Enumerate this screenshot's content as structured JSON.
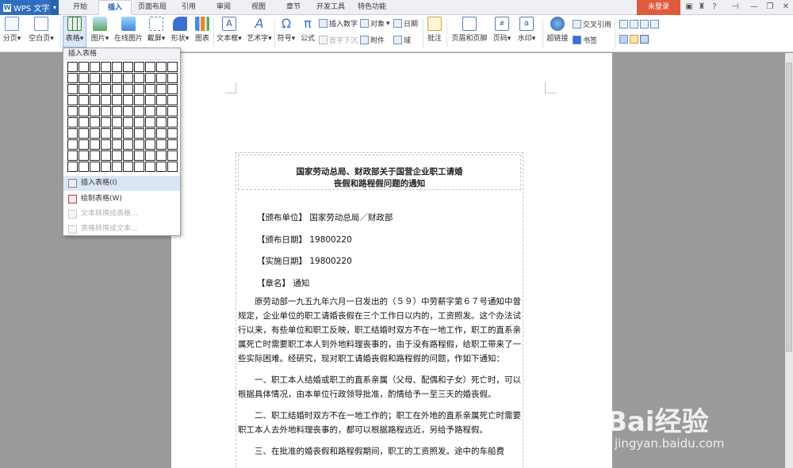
{
  "app": {
    "name": "WPS 文字"
  },
  "tabs": [
    "开始",
    "插入",
    "页面布局",
    "引用",
    "审阅",
    "视图",
    "章节",
    "开发工具",
    "特色功能"
  ],
  "login": "未登录",
  "ribbon": {
    "page_break": "分页",
    "blank_page": "空白页",
    "table": "表格",
    "picture": "图片",
    "online_picture": "在线图片",
    "screenshot": "截屏",
    "shape": "形状",
    "chart": "图表",
    "textbox": "文本框",
    "wordart": "艺术字",
    "symbol": "符号",
    "formula": "公式",
    "insert_number": "插入数字",
    "object": "对象",
    "date": "日期",
    "first_letter": "首字下沉",
    "attachment": "附件",
    "field": "域",
    "comment": "批注",
    "header_footer": "页眉和页脚",
    "page_number": "页码",
    "watermark": "水印",
    "hyperlink": "超链接",
    "cross_ref": "交叉引用",
    "bookmark": "书签"
  },
  "menu": {
    "header": "插入表格",
    "items": [
      "插入表格(I)",
      "绘制表格(W)",
      "文本转换成表格...",
      "表格转换成文本..."
    ]
  },
  "doc": {
    "title_line1": "国家劳动总局、财政部关于国营企业职工请婚",
    "title_line2": "丧假和路程假问题的通知",
    "issuer": "【颁布单位】 国家劳动总局／财政部",
    "issue_date": "【颁布日期】 19800220",
    "effective_date": "【实施日期】 19800220",
    "chapter": "【章名】 通知",
    "para1": "原劳动部一九五九年六月一日发出的（５９）中劳薪字第６７号通知中曾规定，企业单位的职工请婚丧假在三个工作日以内的，工资照发。这个办法试行以来，有些单位和职工反映，职工结婚时双方不在一地工作，职工的直系亲属死亡时需要职工本人到外地料理丧事的，由于没有路程假，给职工带来了一些实际困难。经研究，现对职工请婚丧假和路程假的问题，作如下通知：",
    "para2": "一、职工本人结婚或职工的直系亲属（父母、配偶和子女）死亡时，可以根据具体情况，由本单位行政领导批准，酌情给予一至三天的婚丧假。",
    "para3": "二、职工结婚时双方不在一地工作的；职工在外地的直系亲属死亡时需要职工本人去外地料理丧事的，都可以根据路程远近，另给予路程假。",
    "para4": "三、在批准的婚丧假和路程假期间，职工的工资照发。途中的车船费"
  },
  "watermark": {
    "main": "Bai经验",
    "sub": "jingyan.baidu.com"
  }
}
